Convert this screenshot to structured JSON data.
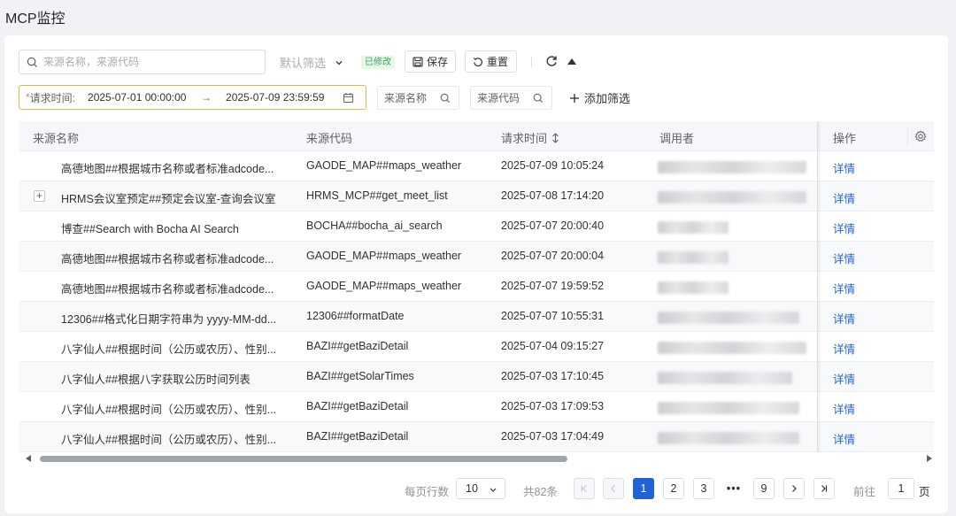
{
  "page_title": "MCP监控",
  "toolbar": {
    "search_placeholder": "来源名称，来源代码",
    "filter_select": "默认筛选",
    "modified_badge": "已修改",
    "save_label": "保存",
    "reset_label": "重置"
  },
  "filters": {
    "required_mark": "*",
    "time_label": "请求时间:",
    "start": "2025-07-01 00:00:00",
    "arrow": "→",
    "end": "2025-07-09 23:59:59",
    "source_name": "来源名称",
    "source_code": "来源代码",
    "add_filter": "添加筛选"
  },
  "table": {
    "headers": {
      "name": "来源名称",
      "code": "来源代码",
      "time": "请求时间",
      "caller": "调用者",
      "op": "操作"
    },
    "rows": [
      {
        "name": "高德地图##根据城市名称或者标准adcode...",
        "code": "GAODE_MAP##maps_weather",
        "time": "2025-07-09 10:05:24",
        "op": "详情"
      },
      {
        "name": "HRMS会议室预定##预定会议室-查询会议室",
        "code": "HRMS_MCP##get_meet_list",
        "time": "2025-07-08 17:14:20",
        "op": "详情",
        "expand": "+"
      },
      {
        "name": "博查##Search with Bocha AI Search",
        "code": "BOCHA##bocha_ai_search",
        "time": "2025-07-07 20:00:40",
        "op": "详情"
      },
      {
        "name": "高德地图##根据城市名称或者标准adcode...",
        "code": "GAODE_MAP##maps_weather",
        "time": "2025-07-07 20:00:04",
        "op": "详情"
      },
      {
        "name": "高德地图##根据城市名称或者标准adcode...",
        "code": "GAODE_MAP##maps_weather",
        "time": "2025-07-07 19:59:52",
        "op": "详情"
      },
      {
        "name": "12306##格式化日期字符串为 yyyy-MM-dd...",
        "code": "12306##formatDate",
        "time": "2025-07-07 10:55:31",
        "op": "详情"
      },
      {
        "name": "八字仙人##根据时间（公历或农历）、性别...",
        "code": "BAZI##getBaziDetail",
        "time": "2025-07-04 09:15:27",
        "op": "详情"
      },
      {
        "name": "八字仙人##根据八字获取公历时间列表",
        "code": "BAZI##getSolarTimes",
        "time": "2025-07-03 17:10:45",
        "op": "详情"
      },
      {
        "name": "八字仙人##根据时间（公历或农历）、性别...",
        "code": "BAZI##getBaziDetail",
        "time": "2025-07-03 17:09:53",
        "op": "详情"
      },
      {
        "name": "八字仙人##根据时间（公历或农历）、性别...",
        "code": "BAZI##getBaziDetail",
        "time": "2025-07-03 17:04:49",
        "op": "详情"
      }
    ]
  },
  "pagination": {
    "page_size_label": "每页行数",
    "page_size": "10",
    "total": "共82条",
    "pages": [
      "1",
      "2",
      "3",
      "•••",
      "9"
    ],
    "goto_label": "前往",
    "goto_value": "1",
    "page_unit": "页"
  },
  "colors": {
    "accent": "#1f63d6",
    "date_border": "#f0b14a",
    "badge_bg": "#e7f7e1",
    "badge_text": "#38a169"
  }
}
